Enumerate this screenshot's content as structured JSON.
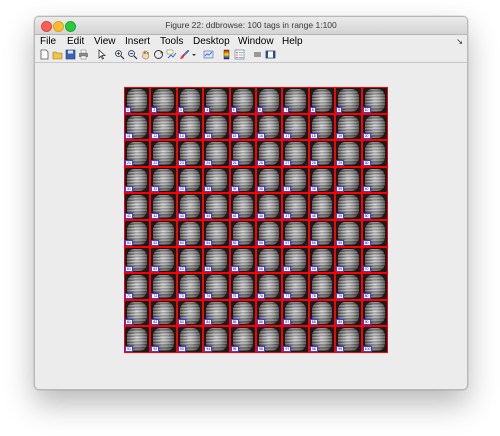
{
  "window": {
    "title": "Figure 22: ddbrowse: 100 tags in range 1:100"
  },
  "menubar": {
    "items": [
      "File",
      "Edit",
      "View",
      "Insert",
      "Tools",
      "Desktop",
      "Window",
      "Help"
    ],
    "dock_glyph": "↘"
  },
  "toolbar": {
    "buttons": [
      {
        "name": "new-figure-icon"
      },
      {
        "name": "open-file-icon"
      },
      {
        "name": "save-icon"
      },
      {
        "name": "print-icon"
      },
      {
        "name": "edit-plot-arrow-icon"
      },
      {
        "name": "zoom-in-icon"
      },
      {
        "name": "zoom-out-icon"
      },
      {
        "name": "pan-hand-icon"
      },
      {
        "name": "rotate-3d-icon"
      },
      {
        "name": "data-cursor-icon"
      },
      {
        "name": "brush-icon"
      },
      {
        "name": "brush-dropdown-icon"
      },
      {
        "name": "link-plot-icon"
      },
      {
        "name": "insert-colorbar-icon"
      },
      {
        "name": "insert-legend-icon"
      },
      {
        "name": "hide-plot-tools-icon"
      },
      {
        "name": "show-plot-tools-icon"
      }
    ]
  },
  "grid": {
    "rows": 10,
    "cols": 10,
    "tags": [
      "1",
      "2",
      "3",
      "4",
      "5",
      "6",
      "7",
      "8",
      "9",
      "10",
      "11",
      "12",
      "13",
      "14",
      "15",
      "16",
      "17",
      "18",
      "19",
      "20",
      "21",
      "22",
      "23",
      "24",
      "25",
      "26",
      "27",
      "28",
      "29",
      "30",
      "31",
      "32",
      "33",
      "34",
      "35",
      "36",
      "37",
      "38",
      "39",
      "40",
      "41",
      "42",
      "43",
      "44",
      "45",
      "46",
      "47",
      "48",
      "49",
      "50",
      "51",
      "52",
      "53",
      "54",
      "55",
      "56",
      "57",
      "58",
      "59",
      "60",
      "61",
      "62",
      "63",
      "64",
      "65",
      "66",
      "67",
      "68",
      "69",
      "70",
      "71",
      "72",
      "73",
      "74",
      "75",
      "76",
      "77",
      "78",
      "79",
      "80",
      "81",
      "82",
      "83",
      "84",
      "85",
      "86",
      "87",
      "88",
      "89",
      "90",
      "91",
      "92",
      "93",
      "94",
      "95",
      "96",
      "97",
      "98",
      "99",
      "100"
    ]
  },
  "colors": {
    "cell_border": "#ff0000",
    "label_border": "#3a3aff",
    "window_bg": "#ececec"
  }
}
